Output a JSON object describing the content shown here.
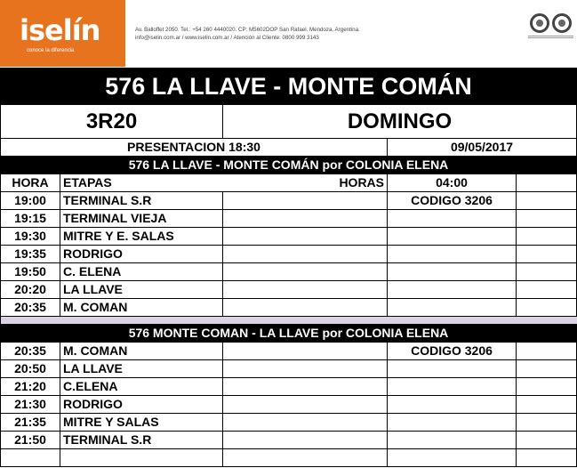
{
  "header": {
    "logo_text": "iselín",
    "logo_tagline": "conoce la diferencia",
    "address_line1": "Av. Balloffet 2050. Tel.: +54 260 4440020. CP: M5602DOP San Rafael. Mendoza. Argentina.",
    "address_line2": "info@iselin.com.ar / www.iselin.com.ar / Atención al Cliente: 0800 999 3143"
  },
  "title": "576  LA LLAVE - MONTE COMÁN",
  "service_code": "3R20",
  "day": "DOMINGO",
  "presentation": "PRESENTACION  18:30",
  "date": "09/05/2017",
  "section1": {
    "heading": "576 LA LLAVE - MONTE COMÁN por COLONIA ELENA",
    "col_hora": "HORA",
    "col_etapas": "ETAPAS",
    "col_horas": "HORAS",
    "horas_value": "04:00",
    "codigo": "CODIGO 3206",
    "rows": [
      {
        "time": "19:00",
        "stage": "TERMINAL S.R"
      },
      {
        "time": "19:15",
        "stage": "TERMINAL VIEJA"
      },
      {
        "time": "19:30",
        "stage": "MITRE Y E. SALAS"
      },
      {
        "time": "19:35",
        "stage": "RODRIGO"
      },
      {
        "time": "19:50",
        "stage": "C. ELENA"
      },
      {
        "time": "20:20",
        "stage": "LA LLAVE"
      },
      {
        "time": "20:35",
        "stage": "M. COMAN"
      }
    ]
  },
  "section2": {
    "heading": "576 MONTE COMAN - LA LLAVE por COLONIA ELENA",
    "codigo": "CODIGO 3206",
    "rows": [
      {
        "time": "20:35",
        "stage": "M. COMAN"
      },
      {
        "time": "20:50",
        "stage": "LA LLAVE"
      },
      {
        "time": "21:20",
        "stage": "C.ELENA"
      },
      {
        "time": "21:30",
        "stage": "RODRIGO"
      },
      {
        "time": "21:35",
        "stage": "MITRE Y SALAS"
      },
      {
        "time": "21:50",
        "stage": "TERMINAL S.R"
      },
      {
        "time": "",
        "stage": ""
      }
    ]
  }
}
